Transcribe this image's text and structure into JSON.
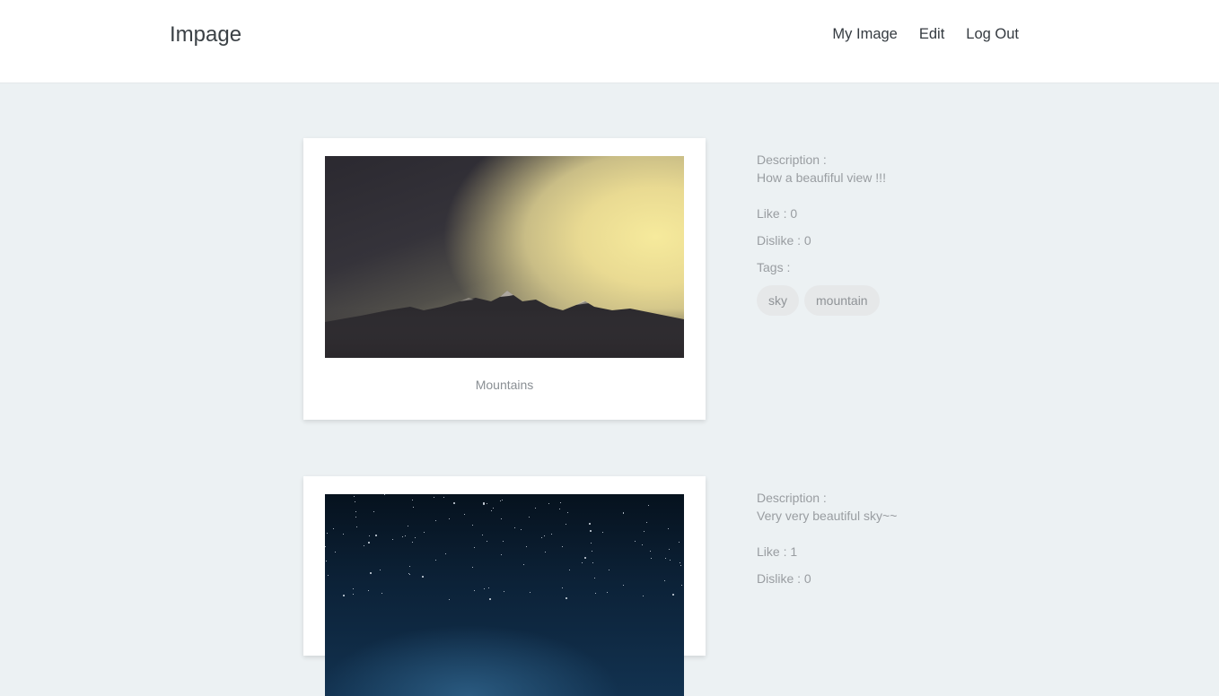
{
  "navbar": {
    "brand": "Impage",
    "links": [
      "My Image",
      "Edit",
      "Log Out"
    ]
  },
  "posts": [
    {
      "title": "Mountains",
      "image_desc": "mountains-photo",
      "description_label": "Description :",
      "description": "How a beaufiful view !!!",
      "like": "Like : 0",
      "dislike": "Dislike : 0",
      "tags_label": "Tags :",
      "tags": [
        "sky",
        "mountain"
      ]
    },
    {
      "image_desc": "night-sky-photo",
      "description_label": "Description :",
      "description": "Very very beautiful sky~~",
      "like": "Like : 1",
      "dislike": "Dislike : 0"
    }
  ],
  "colors": {
    "page_bg": "#ecf1f3",
    "navbar_bg": "#ffffff",
    "text_muted": "#999da1",
    "tag_bg": "#e6e8e9"
  }
}
